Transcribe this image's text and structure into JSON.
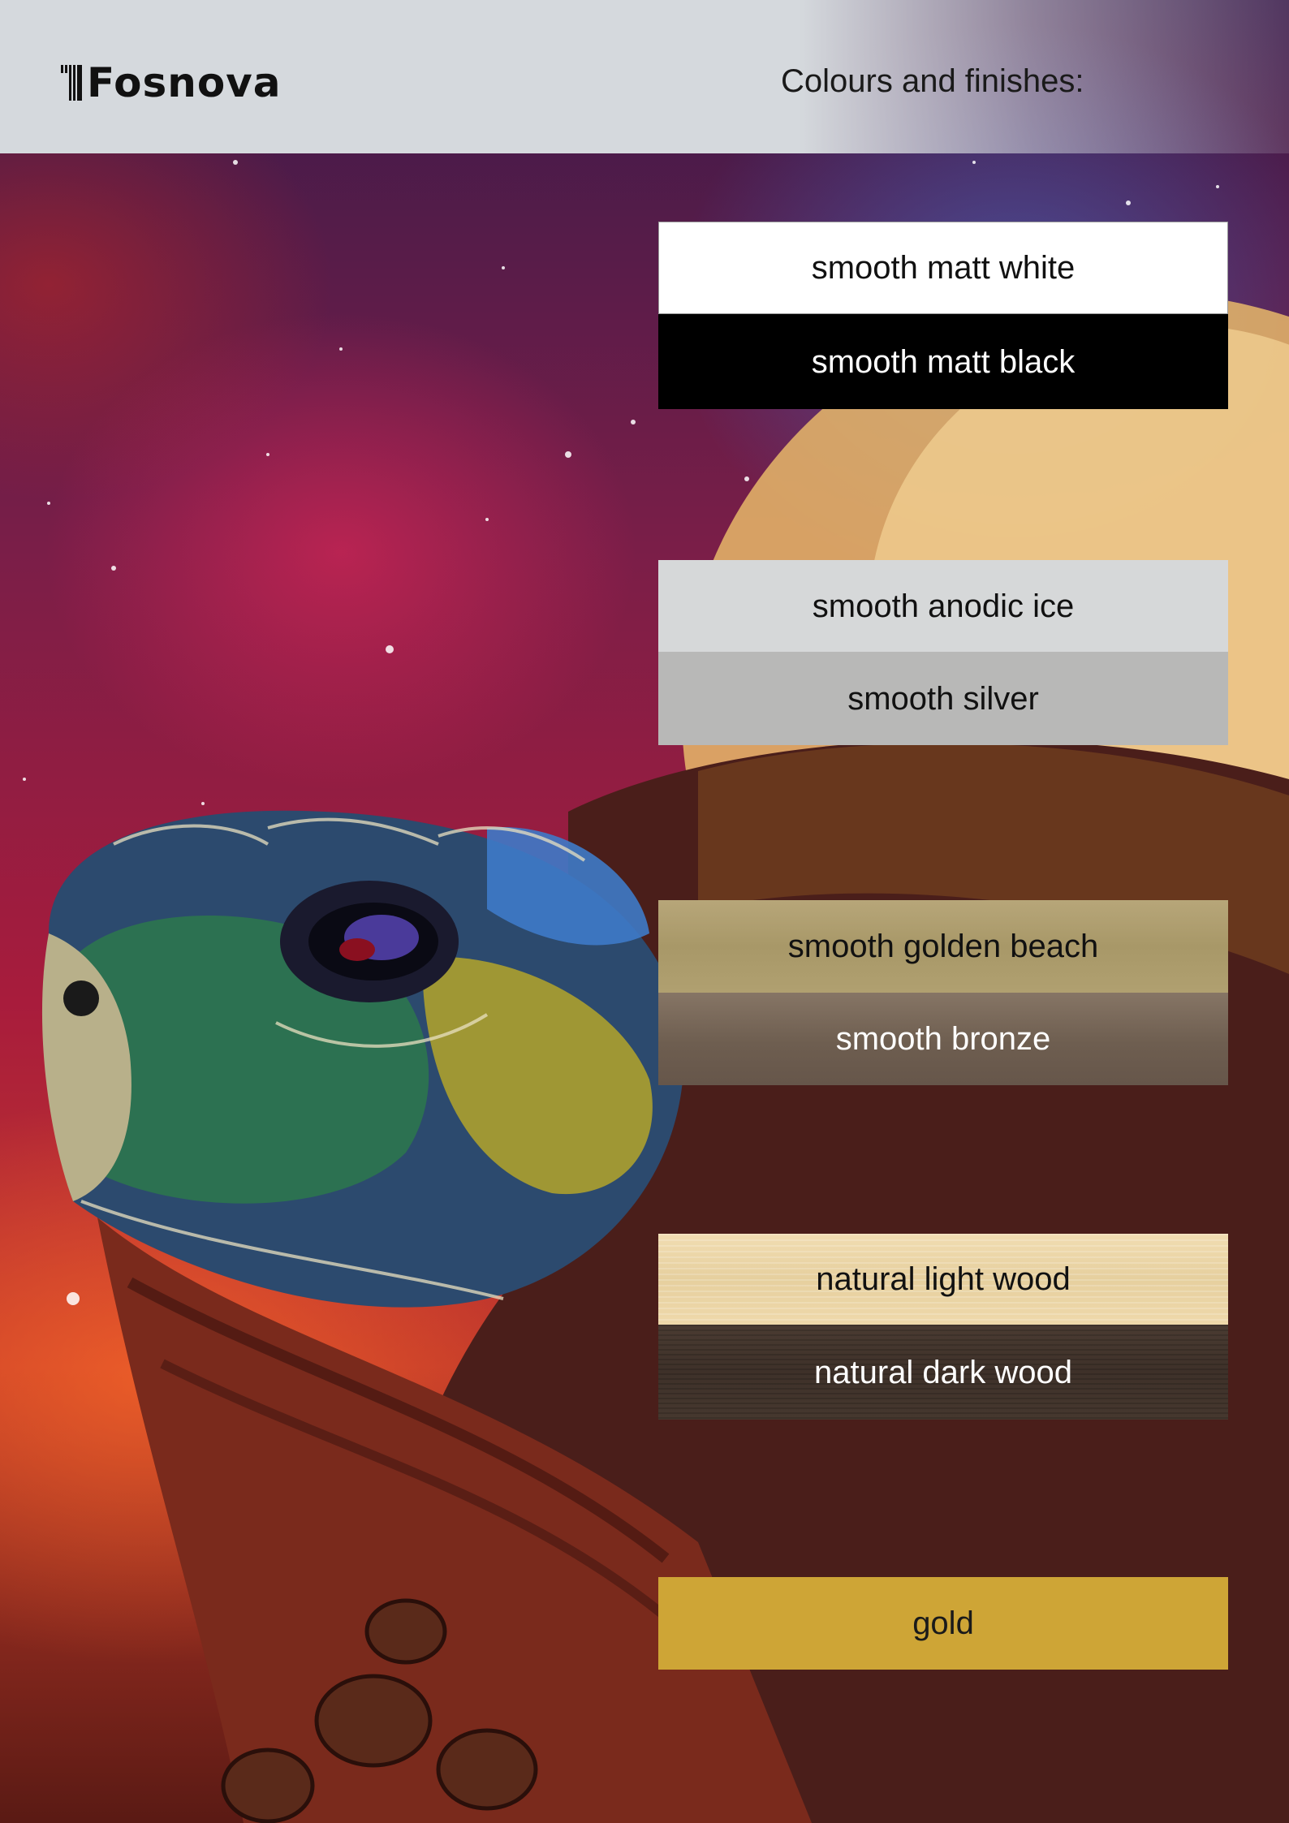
{
  "header": {
    "brand": "Fosnova",
    "title": "Colours and finishes:"
  },
  "swatches": [
    {
      "label": "smooth matt white",
      "color": "#ffffff"
    },
    {
      "label": "smooth matt black",
      "color": "#000000"
    },
    {
      "label": "smooth anodic ice",
      "color": "#d6d8d9"
    },
    {
      "label": "smooth silver",
      "color": "#b8b8b7"
    },
    {
      "label": "smooth golden beach",
      "color": "#b0a070"
    },
    {
      "label": "smooth bronze",
      "color": "#6e5e50"
    },
    {
      "label": "natural light wood",
      "color": "#ecd6a6"
    },
    {
      "label": "natural dark wood",
      "color": "#433630"
    },
    {
      "label": "gold",
      "color": "#cea536"
    }
  ]
}
